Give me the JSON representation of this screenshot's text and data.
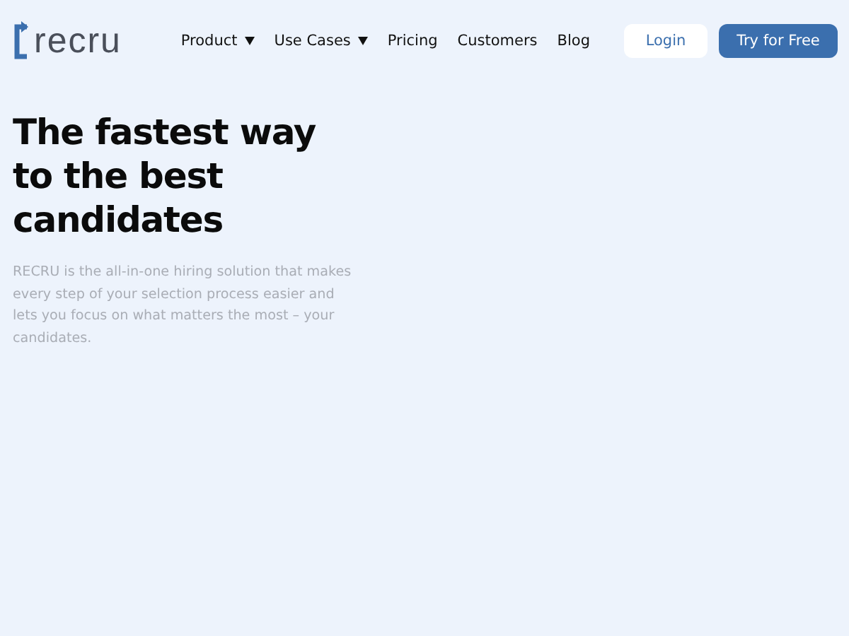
{
  "logo": {
    "text": "recru"
  },
  "nav": [
    {
      "label": "Product",
      "dropdown": true
    },
    {
      "label": "Use Cases",
      "dropdown": true
    },
    {
      "label": "Pricing",
      "dropdown": false
    },
    {
      "label": "Customers",
      "dropdown": false
    },
    {
      "label": "Blog",
      "dropdown": false
    }
  ],
  "buttons": [
    {
      "label": "Login",
      "kind": "secondary"
    },
    {
      "label": "Try for Free",
      "kind": "primary"
    }
  ],
  "hero": {
    "title": "The fastest way to the best candidates",
    "description": "RECRU is the all-in-one hiring solution that makes every step of your selection process easier and lets you focus on what matters the most – your candidates."
  }
}
